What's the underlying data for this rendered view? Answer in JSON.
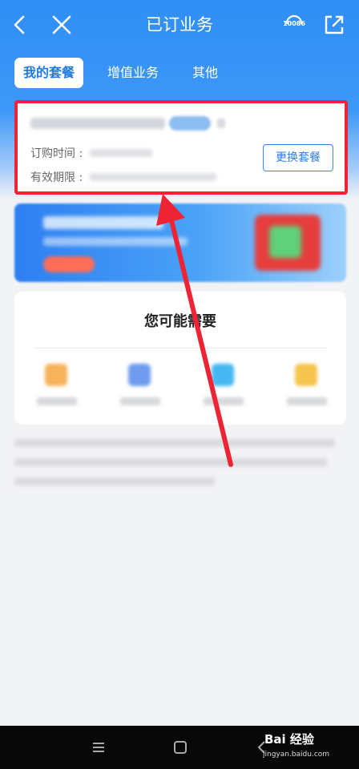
{
  "header": {
    "title": "已订业务",
    "phone_number": "10086"
  },
  "tabs": [
    {
      "label": "我的套餐",
      "active": true
    },
    {
      "label": "增值业务",
      "active": false
    },
    {
      "label": "其他",
      "active": false
    }
  ],
  "package": {
    "order_time_label": "订购时间 :",
    "valid_period_label": "有效期限 :",
    "change_button": "更换套餐"
  },
  "needs": {
    "title": "您可能需要"
  },
  "watermark": {
    "brand": "Bai 经验",
    "url": "jingyan.baidu.com"
  },
  "colors": {
    "primary": "#2f8ef5",
    "highlight_box": "#ee2333",
    "button_text": "#2b7ce6"
  }
}
